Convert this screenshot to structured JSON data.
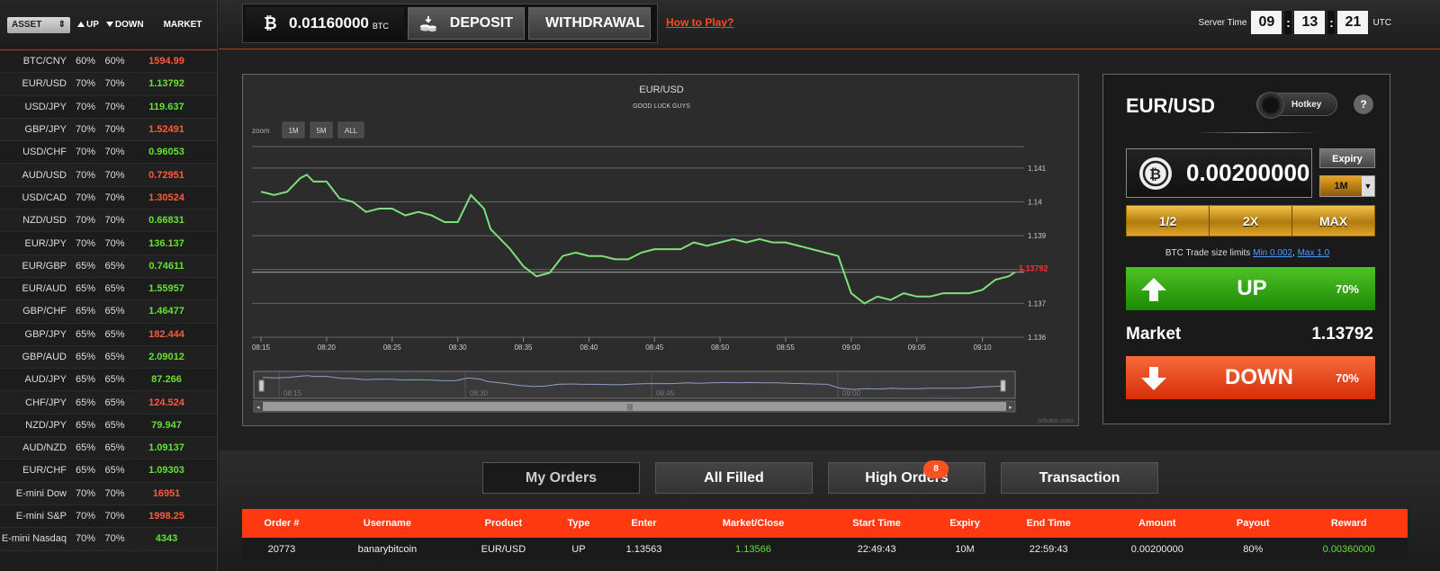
{
  "sidebar": {
    "asset_select": "ASSET",
    "hdr_up": "UP",
    "hdr_down": "DOWN",
    "hdr_market": "MARKET",
    "assets": [
      {
        "name": "BTC/CNY",
        "up": "60%",
        "down": "60%",
        "market": "1594.99",
        "trend": "red"
      },
      {
        "name": "EUR/USD",
        "up": "70%",
        "down": "70%",
        "market": "1.13792",
        "trend": "green"
      },
      {
        "name": "USD/JPY",
        "up": "70%",
        "down": "70%",
        "market": "119.637",
        "trend": "green"
      },
      {
        "name": "GBP/JPY",
        "up": "70%",
        "down": "70%",
        "market": "1.52491",
        "trend": "red"
      },
      {
        "name": "USD/CHF",
        "up": "70%",
        "down": "70%",
        "market": "0.96053",
        "trend": "green"
      },
      {
        "name": "AUD/USD",
        "up": "70%",
        "down": "70%",
        "market": "0.72951",
        "trend": "red"
      },
      {
        "name": "USD/CAD",
        "up": "70%",
        "down": "70%",
        "market": "1.30524",
        "trend": "red"
      },
      {
        "name": "NZD/USD",
        "up": "70%",
        "down": "70%",
        "market": "0.66831",
        "trend": "green"
      },
      {
        "name": "EUR/JPY",
        "up": "70%",
        "down": "70%",
        "market": "136.137",
        "trend": "green"
      },
      {
        "name": "EUR/GBP",
        "up": "65%",
        "down": "65%",
        "market": "0.74611",
        "trend": "green"
      },
      {
        "name": "EUR/AUD",
        "up": "65%",
        "down": "65%",
        "market": "1.55957",
        "trend": "green"
      },
      {
        "name": "GBP/CHF",
        "up": "65%",
        "down": "65%",
        "market": "1.46477",
        "trend": "green"
      },
      {
        "name": "GBP/JPY",
        "up": "65%",
        "down": "65%",
        "market": "182.444",
        "trend": "red"
      },
      {
        "name": "GBP/AUD",
        "up": "65%",
        "down": "65%",
        "market": "2.09012",
        "trend": "green"
      },
      {
        "name": "AUD/JPY",
        "up": "65%",
        "down": "65%",
        "market": "87.266",
        "trend": "green"
      },
      {
        "name": "CHF/JPY",
        "up": "65%",
        "down": "65%",
        "market": "124.524",
        "trend": "red"
      },
      {
        "name": "NZD/JPY",
        "up": "65%",
        "down": "65%",
        "market": "79.947",
        "trend": "green"
      },
      {
        "name": "AUD/NZD",
        "up": "65%",
        "down": "65%",
        "market": "1.09137",
        "trend": "green"
      },
      {
        "name": "EUR/CHF",
        "up": "65%",
        "down": "65%",
        "market": "1.09303",
        "trend": "green"
      },
      {
        "name": "E-mini Dow",
        "up": "70%",
        "down": "70%",
        "market": "16951",
        "trend": "red"
      },
      {
        "name": "E-mini S&P",
        "up": "70%",
        "down": "70%",
        "market": "1998.25",
        "trend": "red"
      },
      {
        "name": "E-mini Nasdaq",
        "up": "70%",
        "down": "70%",
        "market": "4343",
        "trend": "green"
      }
    ]
  },
  "topbar": {
    "balance_value": "0.01160000",
    "balance_unit": "BTC",
    "deposit_label": "DEPOSIT",
    "withdrawal_label": "WITHDRAWAL",
    "how_to_play": "How to Play?",
    "server_time_label": "Server Time",
    "time_h": "09",
    "time_m": "13",
    "time_s": "21",
    "time_zone": "UTC"
  },
  "chart_data": {
    "type": "line",
    "title": "EUR/USD",
    "subtitle": "GOOD LUCK GUYS",
    "zoom_label": "zoom",
    "zoom_buttons": [
      "1M",
      "5M",
      "ALL"
    ],
    "x_ticks": [
      "08:15",
      "08:20",
      "08:25",
      "08:30",
      "08:35",
      "08:40",
      "08:45",
      "08:50",
      "08:55",
      "09:00",
      "09:05",
      "09:10"
    ],
    "navigator_ticks": [
      "08:15",
      "08:30",
      "08:45",
      "09:00"
    ],
    "y_ticks": [
      1.141,
      1.14,
      1.139,
      1.138,
      1.137,
      1.136
    ],
    "y_tick_labels": [
      "1.141",
      "1.14",
      "1.139",
      "1.137",
      "1.136"
    ],
    "ylim": [
      1.136,
      1.1415
    ],
    "current_value": 1.13792,
    "current_label": "1.13792",
    "x_range_minutes": [
      0,
      57.5
    ],
    "series": [
      {
        "minutes": [
          0,
          1,
          2,
          3,
          3.5,
          4,
          5,
          6,
          7,
          8,
          9,
          10,
          11,
          12,
          13,
          14,
          15,
          16,
          17,
          17.5,
          18,
          19,
          20,
          21,
          22,
          23,
          24,
          25,
          26,
          27,
          28,
          29,
          30,
          31,
          32,
          33,
          34,
          35,
          36,
          37,
          38,
          39,
          40,
          41,
          42,
          43,
          44,
          45,
          46,
          47,
          48,
          49,
          50,
          51,
          52,
          53,
          54,
          55,
          56,
          57,
          57.5
        ],
        "values": [
          1.1403,
          1.1402,
          1.1403,
          1.1407,
          1.1408,
          1.1406,
          1.1406,
          1.1401,
          1.14,
          1.1397,
          1.1398,
          1.1398,
          1.1396,
          1.1397,
          1.1396,
          1.1394,
          1.1394,
          1.1402,
          1.1398,
          1.1392,
          1.139,
          1.1386,
          1.1381,
          1.1378,
          1.1379,
          1.1384,
          1.1385,
          1.1384,
          1.1384,
          1.1383,
          1.1383,
          1.1385,
          1.1386,
          1.1386,
          1.1386,
          1.1388,
          1.1387,
          1.1388,
          1.1389,
          1.1388,
          1.1389,
          1.1388,
          1.1388,
          1.1387,
          1.1386,
          1.1385,
          1.1384,
          1.1373,
          1.137,
          1.1372,
          1.1371,
          1.1373,
          1.1372,
          1.1372,
          1.1373,
          1.1373,
          1.1373,
          1.1374,
          1.1377,
          1.1378,
          1.13792
        ]
      }
    ],
    "watermark": "orbuton.com"
  },
  "trade": {
    "asset": "EUR/USD",
    "hotkey_label": "Hotkey",
    "help": "?",
    "amount": "0.00200000",
    "expiry_label": "Expiry",
    "expiry_value": "1M",
    "multipliers": [
      "1/2",
      "2X",
      "MAX"
    ],
    "limits_text": "BTC Trade size limits",
    "limit_min": "Min 0.002",
    "limit_max": "Max 1.0",
    "up_label": "UP",
    "up_pct": "70%",
    "market_label": "Market",
    "market_value": "1.13792",
    "down_label": "DOWN",
    "down_pct": "70%"
  },
  "bottom": {
    "tabs": [
      {
        "label": "My Orders",
        "active": true
      },
      {
        "label": "All Filled",
        "active": false
      },
      {
        "label": "High Orders",
        "active": false,
        "badge": "8"
      },
      {
        "label": "Transaction",
        "active": false
      }
    ],
    "columns": [
      "Order #",
      "Username",
      "Product",
      "Type",
      "Enter",
      "Market/Close",
      "Start Time",
      "Expiry",
      "End Time",
      "Amount",
      "Payout",
      "Reward"
    ],
    "rows": [
      [
        "20773",
        "banarybitcoin",
        "EUR/USD",
        "UP",
        "1.13563",
        "1.13566",
        "22:49:43",
        "10M",
        "22:59:43",
        "0.00200000",
        "80%",
        "0.00360000"
      ]
    ]
  },
  "colors": {
    "accent": "#ff3a10",
    "up_green": "#2fa512",
    "down_red": "#e84118",
    "gold": "#d49a1e",
    "chart_line": "#7ee07a"
  }
}
